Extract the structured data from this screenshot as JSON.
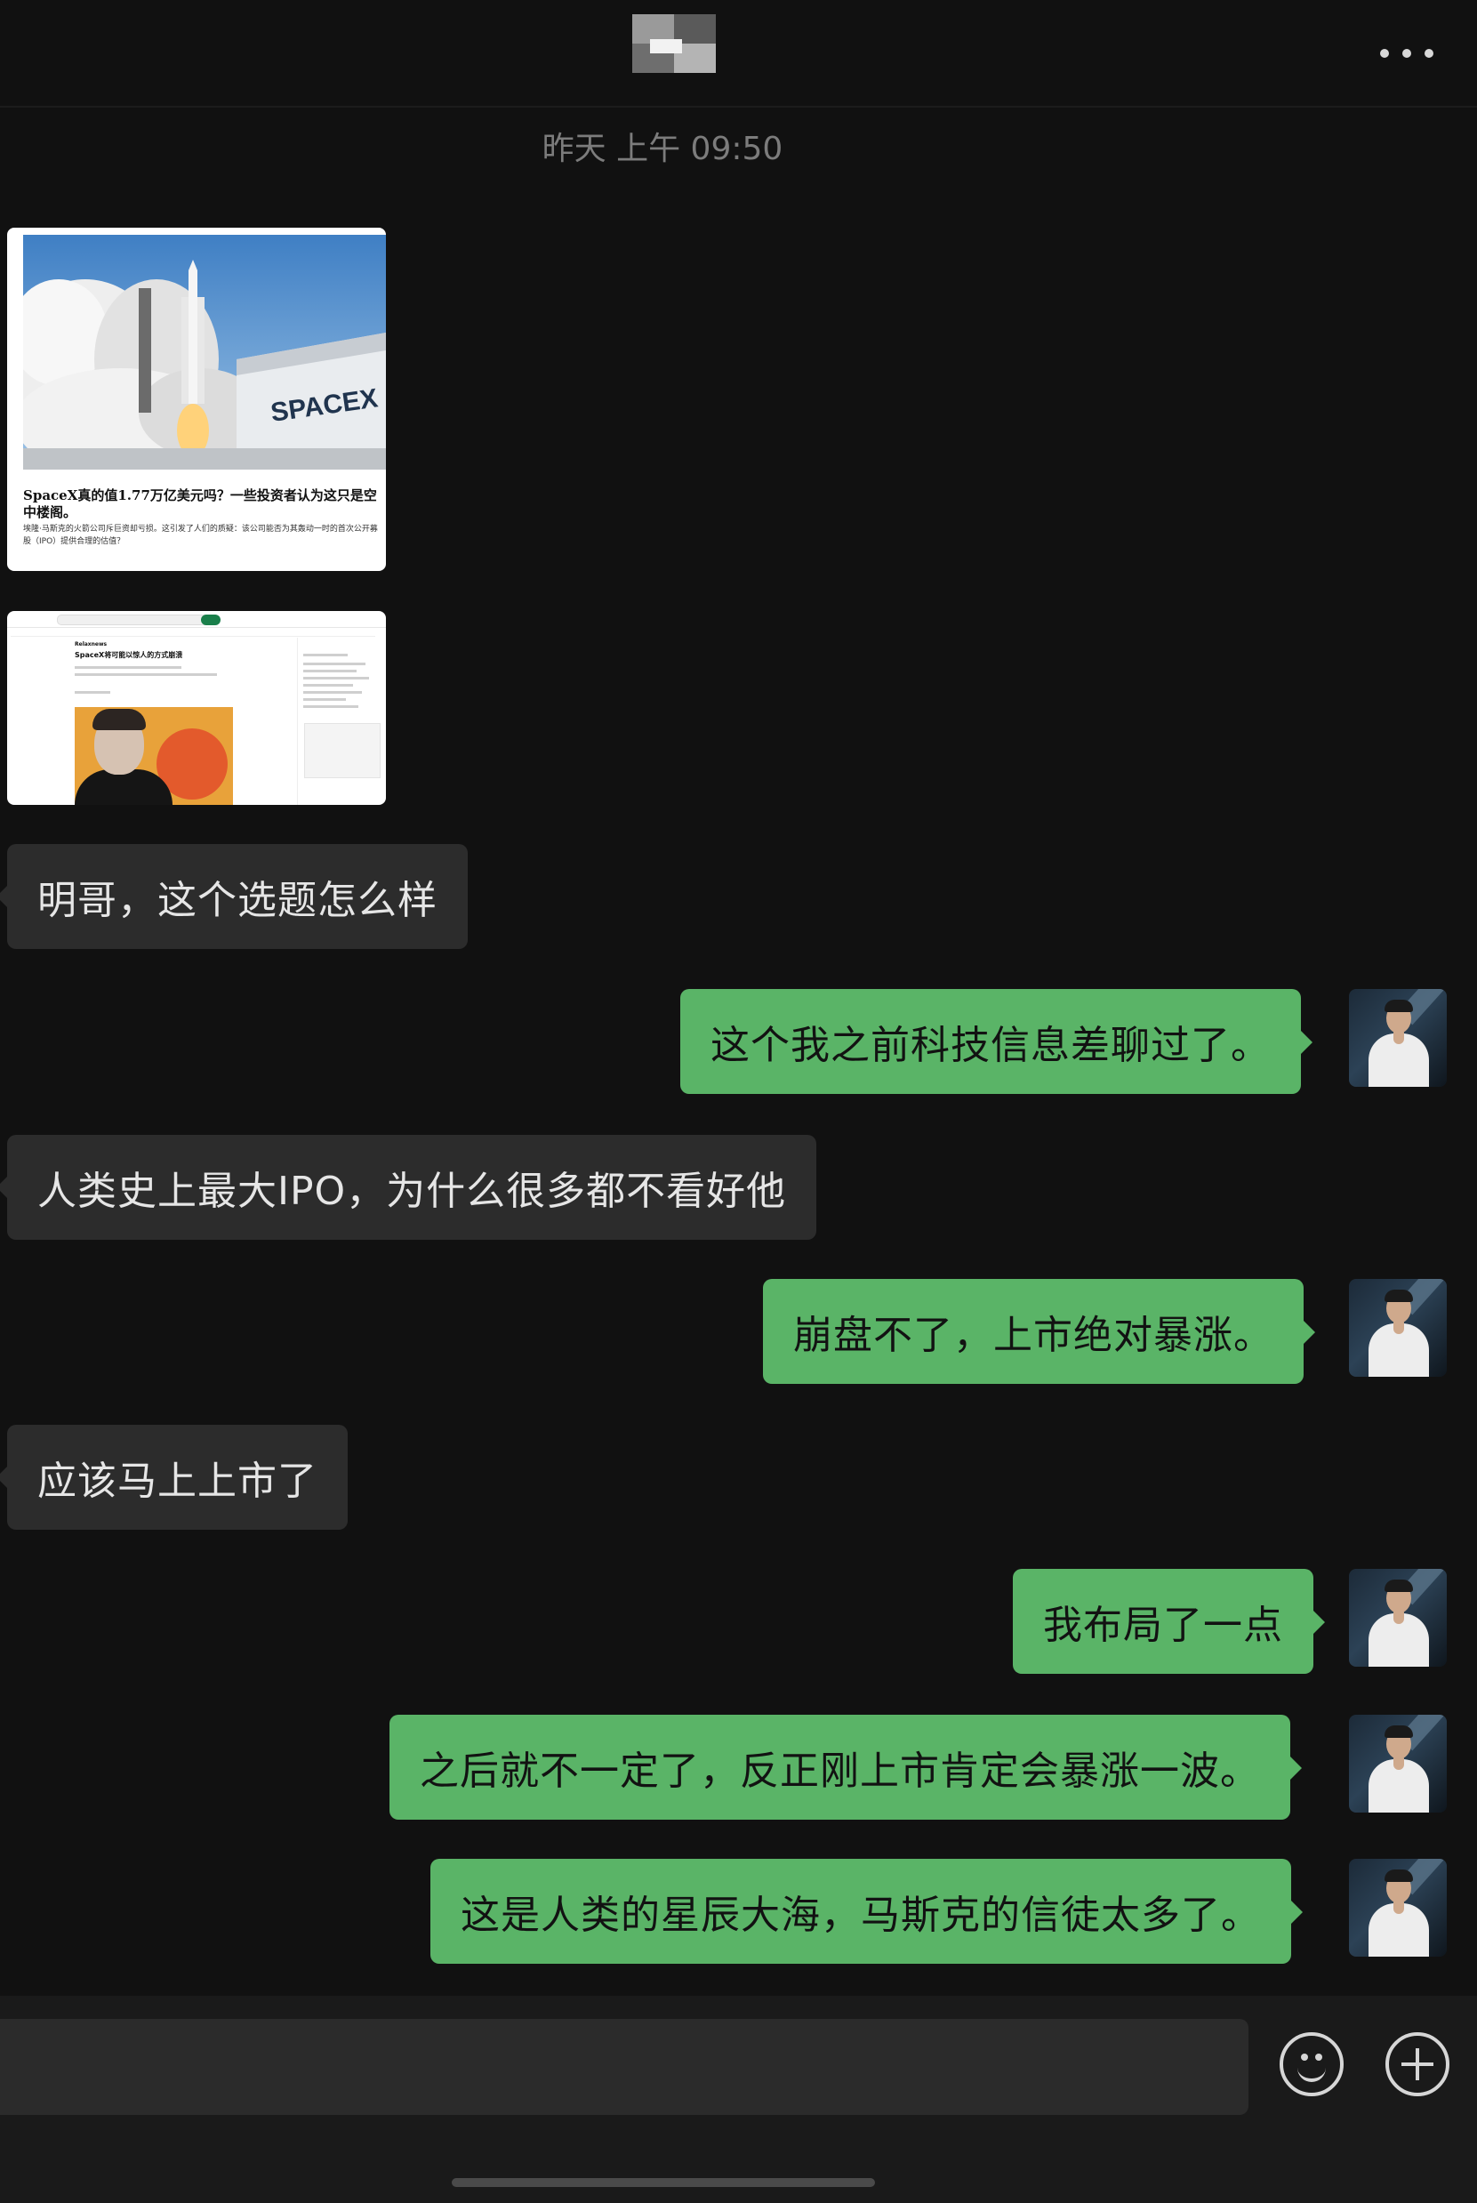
{
  "header": {
    "more_label": "···"
  },
  "timestamp": "昨天 上午 09:50",
  "image_messages": [
    {
      "headline": "SpaceX真的值1.77万亿美元吗？一些投资者认为这只是空中楼阁。",
      "summary": "埃隆·马斯克的火箭公司斥巨资却亏损。这引发了人们的质疑：该公司能否为其轰动一时的首次公开募股（IPO）提供合理的估值？",
      "photo_text": "SPACEX"
    },
    {
      "section": "Relaxnews",
      "title": "SpaceX将可能以惊人的方式崩溃"
    }
  ],
  "messages": [
    {
      "side": "in",
      "text": "明哥，这个选题怎么样"
    },
    {
      "side": "out",
      "text": "这个我之前科技信息差聊过了。"
    },
    {
      "side": "in",
      "text": "人类史上最大IPO，为什么很多都不看好他"
    },
    {
      "side": "out",
      "text": "崩盘不了，上市绝对暴涨。"
    },
    {
      "side": "in",
      "text": "应该马上上市了"
    },
    {
      "side": "out",
      "text": "我布局了一点"
    },
    {
      "side": "out",
      "text": "之后就不一定了，反正刚上市肯定会暴涨一波。"
    },
    {
      "side": "out",
      "text": "这是人类的星辰大海，马斯克的信徒太多了。"
    }
  ],
  "input_bar": {
    "emoji_icon": "smiley-icon",
    "add_icon": "plus-circle-icon"
  },
  "colors": {
    "background": "#111111",
    "incoming_bubble": "#2c2c2c",
    "outgoing_bubble": "#5ab467"
  }
}
